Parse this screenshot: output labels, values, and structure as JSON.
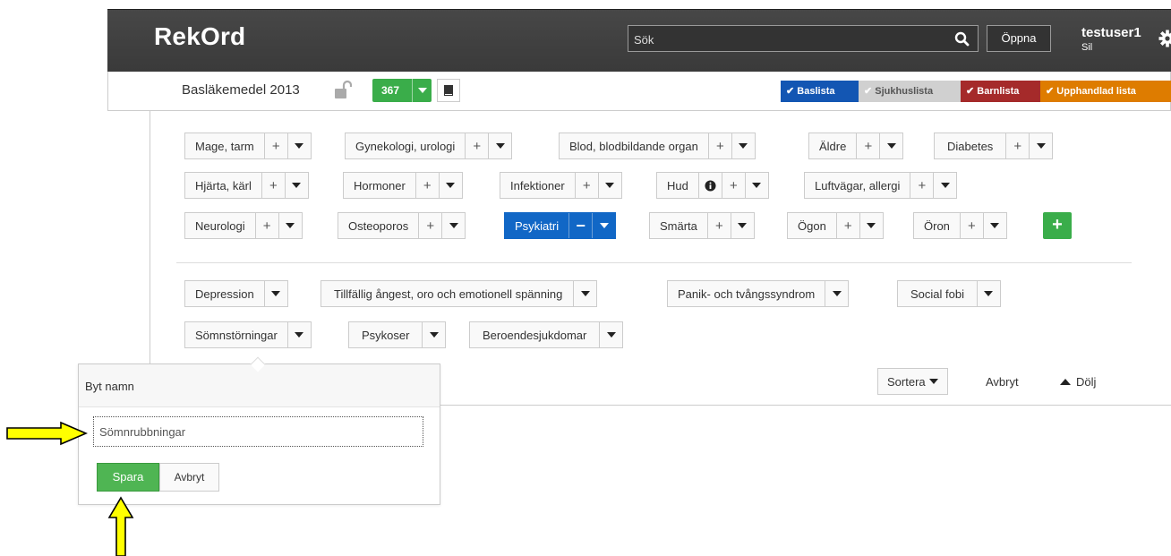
{
  "header": {
    "brand": "RekOrd",
    "search_placeholder": "Sök",
    "open_label": "Öppna",
    "username": "testuser1",
    "user_sub": "Sil"
  },
  "subbar": {
    "list_title": "Basläkemedel 2013",
    "count": "367",
    "tags": [
      {
        "label": "Baslista",
        "color": "#1356b3"
      },
      {
        "label": "Sjukhuslista",
        "color": "#d0d0d0"
      },
      {
        "label": "Barnlista",
        "color": "#a52a2a"
      },
      {
        "label": "Upphandlad lista",
        "color": "#de7c00"
      }
    ]
  },
  "categories": {
    "row1": [
      "Mage, tarm",
      "Gynekologi, urologi",
      "Blod, blodbildande organ",
      "Äldre",
      "Diabetes"
    ],
    "row2": [
      "Hjärta, kärl",
      "Hormoner",
      "Infektioner",
      "Hud",
      "Luftvägar, allergi"
    ],
    "row3": [
      "Neurologi",
      "Osteoporos",
      "Psykiatri",
      "Smärta",
      "Ögon",
      "Öron"
    ],
    "add_label": "+",
    "active": "Psykiatri"
  },
  "subcategories": {
    "row1": [
      "Depression",
      "Tillfällig ångest, oro och emotionell spänning",
      "Panik- och tvångssyndrom",
      "Social fobi"
    ],
    "row2": [
      "Sömnstörningar",
      "Psykoser",
      "Beroendesjukdomar"
    ]
  },
  "footer": {
    "sort_label": "Sortera",
    "cancel_label": "Avbryt",
    "hide_label": "Dölj"
  },
  "rename_popover": {
    "title": "Byt namn",
    "input_value": "Sömnrubbningar",
    "save_label": "Spara",
    "cancel_label": "Avbryt"
  },
  "colors": {
    "green": "#3aad4a",
    "active_blue": "#1167c6",
    "annotation_yellow": "#ffff00"
  }
}
